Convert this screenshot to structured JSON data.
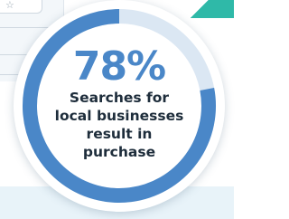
{
  "chart_data": {
    "type": "pie",
    "variant": "donut",
    "value_percent": 78,
    "value_label": "78%",
    "caption": "Searches for local businesses result in purchase",
    "caption_lines": [
      "Searches for",
      "local businesses",
      "result in",
      "purchase"
    ],
    "colors": {
      "filled": "#4a87c8",
      "remainder": "#dbe7f3",
      "value_text": "#4a87c8",
      "caption_text": "#1e2d3b"
    }
  },
  "background": {
    "bookmark_icon": "☆"
  }
}
